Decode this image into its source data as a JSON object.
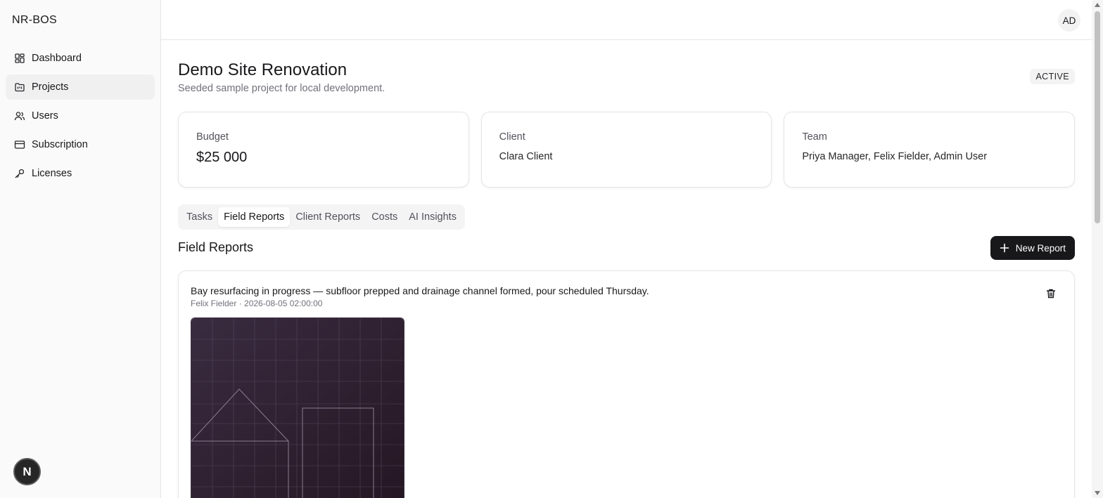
{
  "app": {
    "brand": "NR-BOS"
  },
  "sidebar": {
    "items": [
      {
        "label": "Dashboard",
        "icon": "dashboard-icon"
      },
      {
        "label": "Projects",
        "icon": "folder-icon",
        "active": true
      },
      {
        "label": "Users",
        "icon": "users-icon"
      },
      {
        "label": "Subscription",
        "icon": "credit-card-icon"
      },
      {
        "label": "Licenses",
        "icon": "key-icon"
      }
    ],
    "dev_badge": "N"
  },
  "header": {
    "avatar_initials": "AD"
  },
  "project": {
    "title": "Demo Site Renovation",
    "subtitle": "Seeded sample project for local development.",
    "status": "ACTIVE"
  },
  "summary": {
    "budget": {
      "label": "Budget",
      "value": "$25 000"
    },
    "client": {
      "label": "Client",
      "value": "Clara Client"
    },
    "team": {
      "label": "Team",
      "value": "Priya Manager, Felix Fielder, Admin User"
    }
  },
  "tabs": [
    {
      "label": "Tasks"
    },
    {
      "label": "Field Reports",
      "active": true
    },
    {
      "label": "Client Reports"
    },
    {
      "label": "Costs"
    },
    {
      "label": "AI Insights"
    }
  ],
  "field_reports": {
    "title": "Field Reports",
    "new_button_label": "New Report",
    "reports": [
      {
        "text": "Bay resurfacing in progress — subfloor prepped and drainage channel formed, pour scheduled Thursday.",
        "meta": "Felix Fielder · 2026-08-05 02:00:00"
      }
    ]
  },
  "colors": {
    "accent": "#18181b",
    "photo_bg_dark": "#241622",
    "photo_bg_light": "#3a2c40"
  }
}
